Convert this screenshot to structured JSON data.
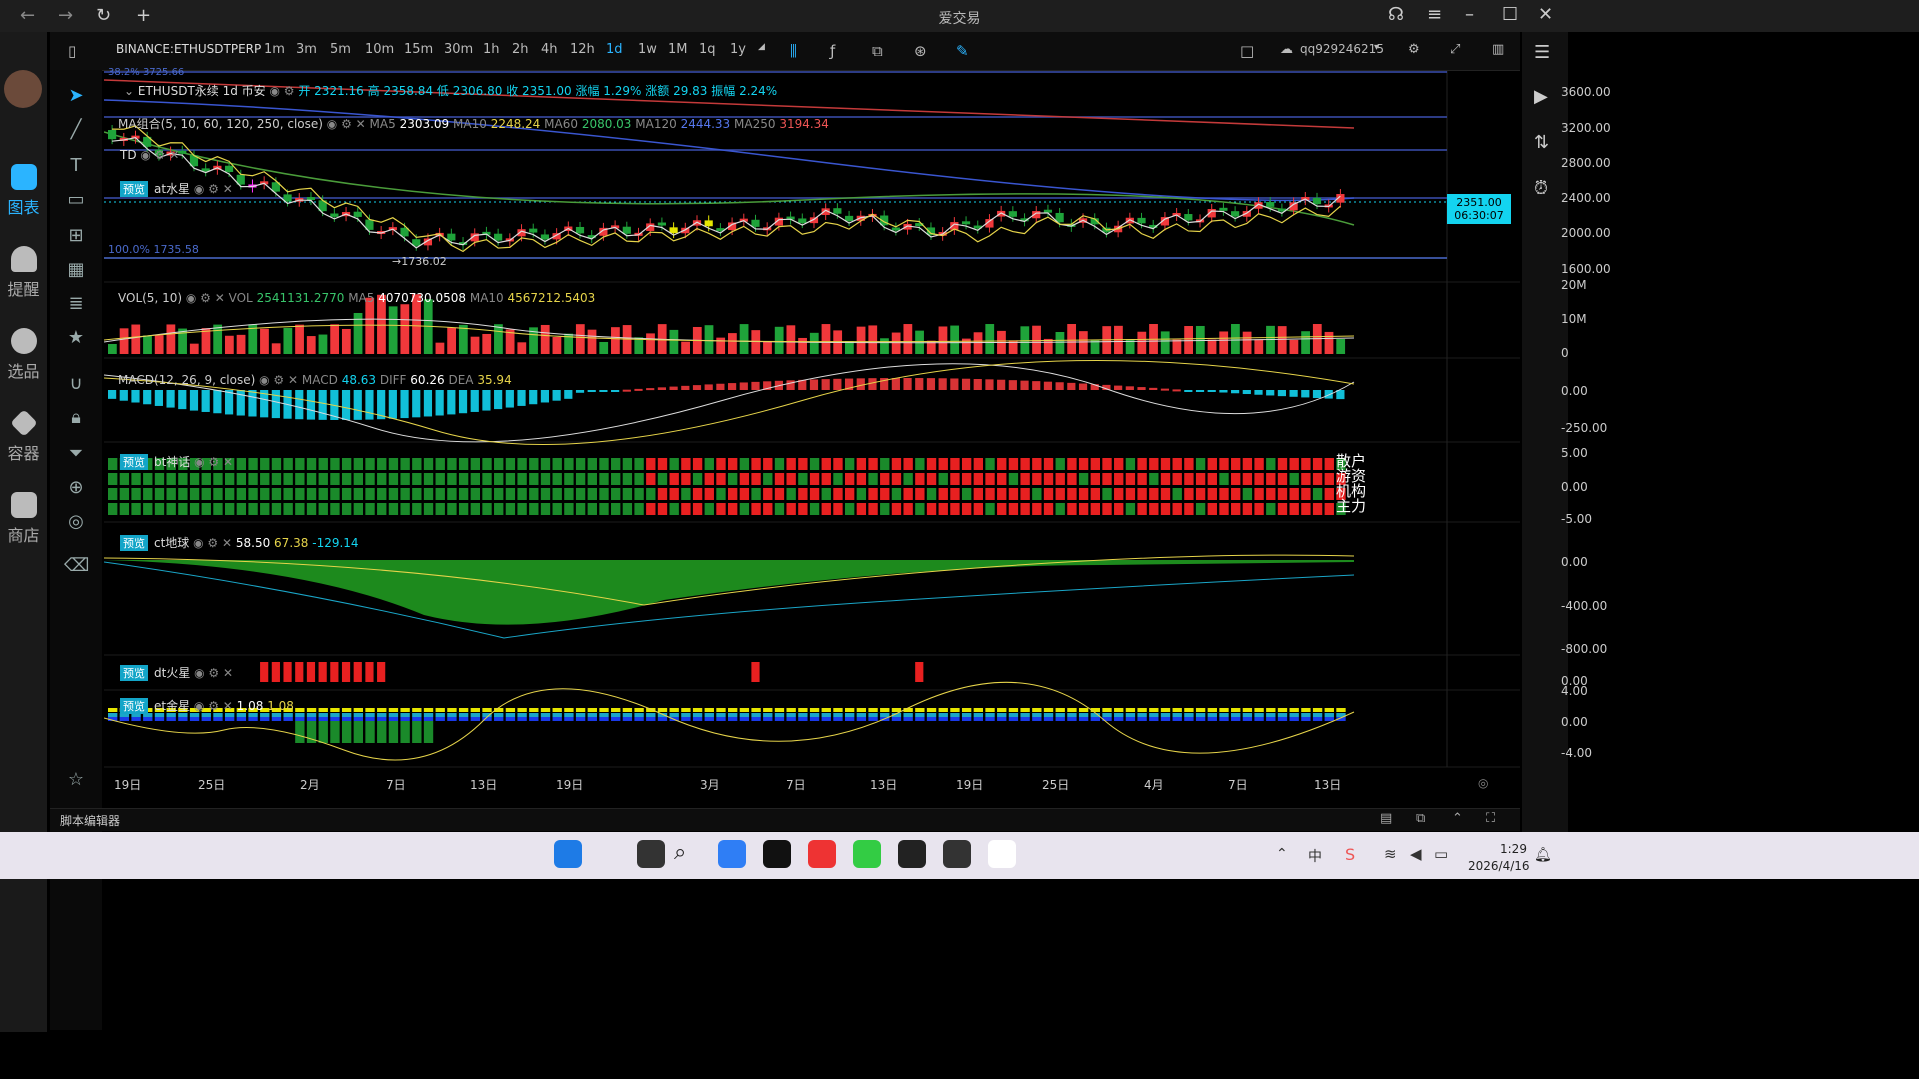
{
  "window": {
    "title": "爱交易"
  },
  "nav": [
    {
      "label": "图表"
    },
    {
      "label": "提醒"
    },
    {
      "label": "选品"
    },
    {
      "label": "容器"
    },
    {
      "label": "商店"
    }
  ],
  "toolbar": {
    "symbol": "BINANCE:ETHUSDTPERP",
    "timeframes": [
      "1m",
      "3m",
      "5m",
      "10m",
      "15m",
      "30m",
      "1h",
      "2h",
      "4h",
      "12h",
      "1d",
      "1w",
      "1M",
      "1q",
      "1y"
    ],
    "active_timeframe": "1d",
    "user": "qq929246215"
  },
  "main_legend": {
    "title": "ETHUSDT永续 1d 币安",
    "open": "开 2321.16",
    "high": "高 2358.84",
    "low": "低 2306.80",
    "close": "收 2351.00",
    "chg_pct": "涨幅 1.29%",
    "chg_amt": "涨额 29.83",
    "amplitude": "振幅 2.24%"
  },
  "ma_legend": {
    "name": "MA组合(5, 10, 60, 120, 250, close)",
    "ma5_label": "MA5",
    "ma5": "2303.09",
    "ma10_label": "MA10",
    "ma10": "2248.24",
    "ma60_label": "MA60",
    "ma60": "2080.03",
    "ma120_label": "MA120",
    "ma120": "2444.33",
    "ma250_label": "MA250",
    "ma250": "3194.34"
  },
  "td_legend": {
    "name": "TD"
  },
  "at_legend": {
    "badge": "预览",
    "name": "at水星"
  },
  "fib": {
    "a": "38.2% 3725.66",
    "b": "100.0% 1735.58",
    "low": "1736.02"
  },
  "price_axis": [
    "3600.00",
    "3200.00",
    "2800.00",
    "2400.00",
    "2000.00",
    "1600.00"
  ],
  "last_price": {
    "price": "2351.00",
    "countdown": "06:30:07"
  },
  "vol_legend": {
    "name": "VOL(5, 10)",
    "vol_label": "VOL",
    "vol": "2541131.2770",
    "ma5_label": "MA5",
    "ma5": "4070730.0508",
    "ma10_label": "MA10",
    "ma10": "4567212.5403"
  },
  "vol_axis": [
    "20M",
    "10M",
    "0"
  ],
  "macd_legend": {
    "name": "MACD(12, 26, 9, close)",
    "macd_label": "MACD",
    "macd": "48.63",
    "diff_label": "DIFF",
    "diff": "60.26",
    "dea_label": "DEA",
    "dea": "35.94"
  },
  "macd_axis": [
    "0.00",
    "-250.00"
  ],
  "bt_legend": {
    "badge": "预览",
    "name": "bt神话",
    "rows": [
      "散户",
      "游资",
      "机构",
      "主力"
    ]
  },
  "bt_axis": [
    "5.00",
    "0.00",
    "-5.00"
  ],
  "ct_legend": {
    "badge": "预览",
    "name": "ct地球",
    "v1": "58.50",
    "v2": "67.38",
    "v3": "-129.14"
  },
  "ct_axis": [
    "0.00",
    "-400.00",
    "-800.00"
  ],
  "dt_legend": {
    "badge": "预览",
    "name": "dt火星"
  },
  "dt_axis": [
    "0.00"
  ],
  "et_legend": {
    "badge": "预览",
    "name": "et金星",
    "v1": "1.08",
    "v2": "1.08"
  },
  "et_axis": [
    "4.00",
    "0.00",
    "-4.00"
  ],
  "xaxis": [
    "19日",
    "25日",
    "2月",
    "7日",
    "13日",
    "19日",
    "3月",
    "7日",
    "13日",
    "19日",
    "25日",
    "4月",
    "7日",
    "13日"
  ],
  "bottom": {
    "script_editor": "脚本编辑器"
  },
  "taskbar": {
    "time": "1:29",
    "date": "2026/4/16"
  },
  "colors": {
    "up": "#f0383b",
    "down": "#1fa33a",
    "accent": "#13d4f0",
    "ma5": "#dddddd",
    "ma10": "#e6d44a"
  }
}
